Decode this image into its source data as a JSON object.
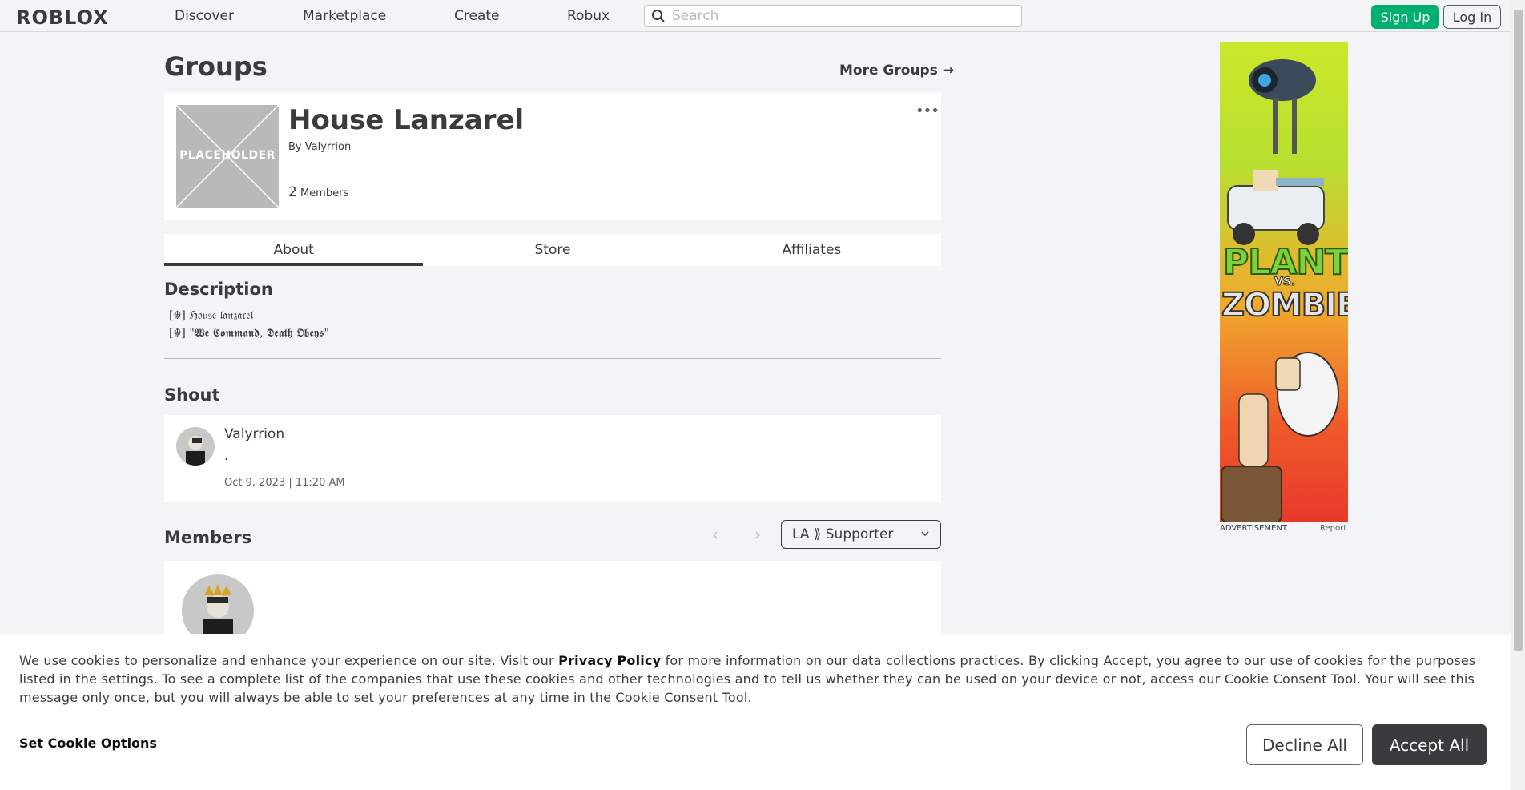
{
  "nav": {
    "logo": "ROBLOX",
    "links": [
      "Discover",
      "Marketplace",
      "Create",
      "Robux"
    ],
    "search_placeholder": "Search",
    "signup": "Sign Up",
    "login": "Log In"
  },
  "page": {
    "title": "Groups",
    "more_groups": "More Groups →"
  },
  "group": {
    "placeholder_label": "PLACEHOLDER",
    "name": "House Lanzarel",
    "by_label": "By",
    "owner": "Valyrrion",
    "member_count": "2",
    "members_label": "Members",
    "more_options": "•••"
  },
  "tabs": [
    "About",
    "Store",
    "Affiliates"
  ],
  "about": {
    "description_heading": "Description",
    "description_lines": [
      "[☬] ℌ𝔬𝔲𝔰𝔢 𝔩𝔞𝔫𝔷𝔞𝔯𝔢𝔩",
      "[☬] \"𝖂𝖊 𝕮𝖔𝖒𝖒𝖆𝖓𝖉, 𝕯𝖊𝖆𝖙𝖍 𝕺𝖇𝖊𝖞𝖘\""
    ],
    "shout_heading": "Shout",
    "shout": {
      "poster": "Valyrrion",
      "body": ".",
      "date": "Oct 9, 2023 | 11:20 AM"
    },
    "members_heading": "Members",
    "role_filter": "LA ⟫ Supporter"
  },
  "ad": {
    "line1": "PLANTS",
    "vs": "VS.",
    "line2": "ZOMBIES",
    "label": "ADVERTISEMENT",
    "report": "Report"
  },
  "cookie": {
    "text_before": "We use cookies to personalize and enhance your experience on our site. Visit our ",
    "privacy_link": "Privacy Policy",
    "text_after": " for more information on our data collections practices. By clicking Accept, you agree to our use of cookies for the purposes listed in the settings. To see a complete list of the companies that use these cookies and other technologies and to tell us whether they can be used on your device or not, access our Cookie Consent Tool. Your will see this message only once, but you will always be able to set your preferences at any time in the Cookie Consent Tool.",
    "set_options": "Set Cookie Options",
    "decline": "Decline All",
    "accept": "Accept All"
  },
  "colors": {
    "accent_green": "#00b06f",
    "text_dark": "#393b3d",
    "page_bg": "#f2f4f5"
  }
}
